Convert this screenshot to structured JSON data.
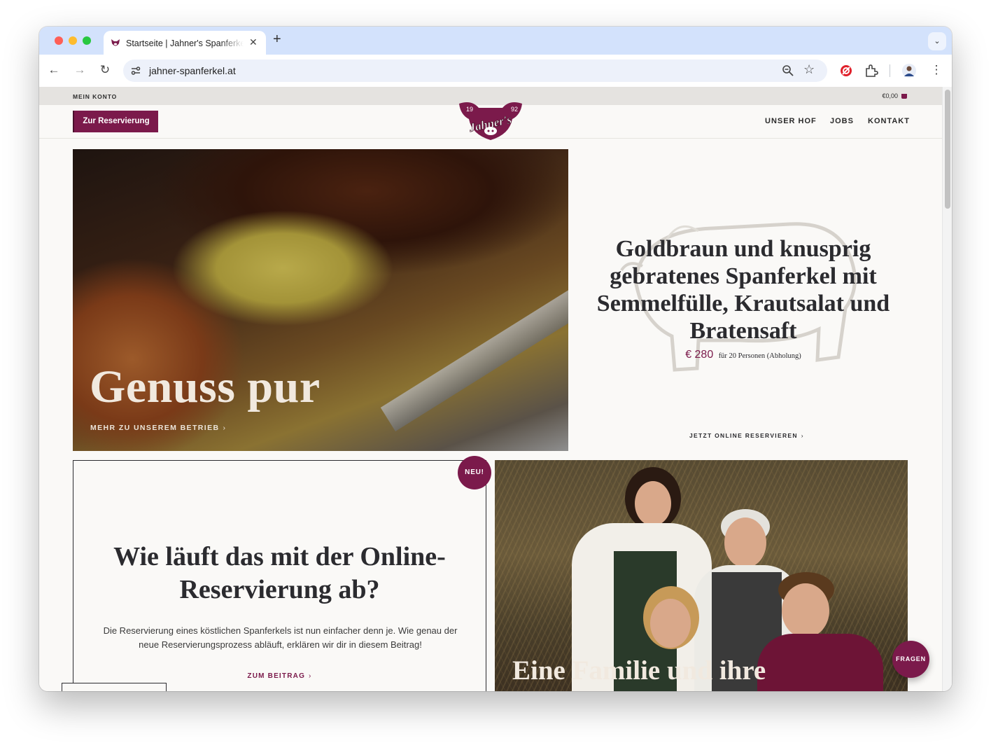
{
  "browser": {
    "tab_title": "Startseite | Jahner's Spanferkel",
    "url": "jahner-spanferkel.at"
  },
  "topbar": {
    "account_label": "MEIN KONTO",
    "cart_total": "€0,00"
  },
  "header": {
    "reserve_button": "Zur Reservierung",
    "logo": {
      "brand": "Jahner's",
      "year_left": "19",
      "year_right": "92"
    },
    "nav": [
      "UNSER HOF",
      "JOBS",
      "KONTAKT"
    ]
  },
  "hero": {
    "title": "Genuss pur",
    "link": "MEHR ZU UNSEREM BETRIEB"
  },
  "offer": {
    "title": "Goldbraun und knusprig gebratenes Spanferkel mit Semmelfülle, Krautsalat und Bratensaft",
    "price": "€ 280",
    "price_note": "für 20 Personen (Abholung)",
    "link": "JETZT ONLINE RESERVIEREN"
  },
  "faq_card": {
    "badge": "NEU!",
    "title": "Wie läuft das mit der Online-Reservierung ab?",
    "text": "Die Reservierung eines köstlichen Spanferkels ist nun einfacher denn je. Wie genau der neue Reservierungsprozess abläuft, erklären wir dir in diesem Beitrag!",
    "link": "ZUM BEITRAG"
  },
  "family": {
    "title": "Eine Familie und ihre"
  },
  "faq_bubble": "FRAGEN",
  "colors": {
    "brand": "#7b1a4b",
    "text": "#2b2b2f",
    "page_bg": "#faf9f7",
    "topbar_bg": "#e5e3e0",
    "tabstrip_bg": "#d3e2fc"
  }
}
